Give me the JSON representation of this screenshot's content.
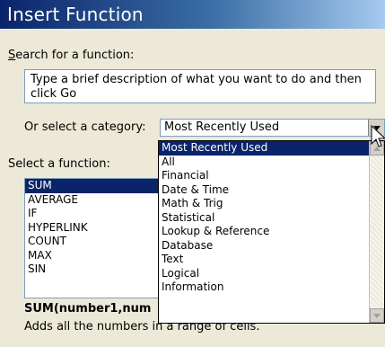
{
  "window": {
    "title": "Insert Function"
  },
  "search": {
    "label": "Search for a function:",
    "value": "Type a brief description of what you want to do and then click Go"
  },
  "category": {
    "label": "Or select a category:",
    "value": "Most Recently Used",
    "options": [
      "Most Recently Used",
      "All",
      "Financial",
      "Date & Time",
      "Math & Trig",
      "Statistical",
      "Lookup & Reference",
      "Database",
      "Text",
      "Logical",
      "Information"
    ]
  },
  "functions": {
    "label": "Select a function:",
    "items": [
      "SUM",
      "AVERAGE",
      "IF",
      "HYPERLINK",
      "COUNT",
      "MAX",
      "SIN"
    ]
  },
  "details": {
    "syntax": "SUM(number1,num",
    "description": "Adds all the numbers in a range of cells."
  }
}
